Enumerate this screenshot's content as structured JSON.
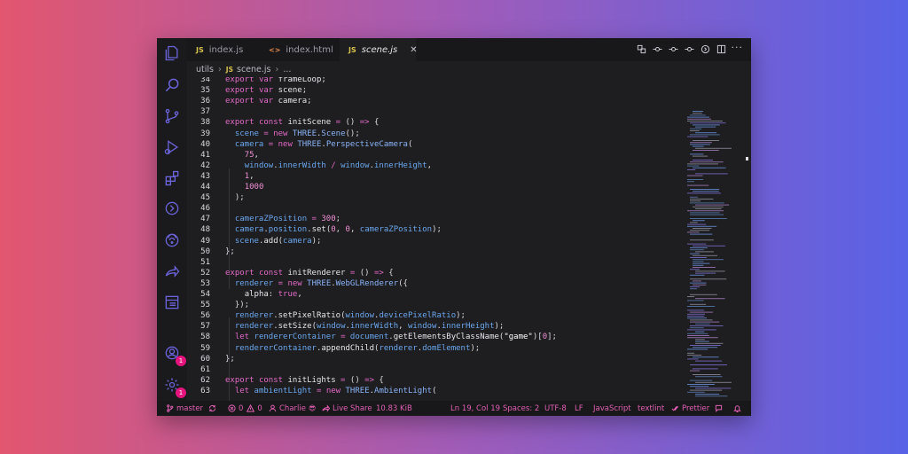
{
  "tabs": [
    {
      "label": "index.js",
      "type": "JS",
      "active": false
    },
    {
      "label": "index.html",
      "type": "<>",
      "active": false
    },
    {
      "label": "scene.js",
      "type": "JS",
      "active": true,
      "close": "✕"
    }
  ],
  "breadcrumb": {
    "folder": "utils",
    "file_type": "JS",
    "file": "scene.js",
    "more": "..."
  },
  "toolbar": {
    "more": "···"
  },
  "code_lines": [
    {
      "n": "34",
      "t": [
        [
          "kw",
          "export "
        ],
        [
          "kw",
          "var "
        ],
        [
          "fn",
          "frameLoop"
        ],
        [
          "p",
          ";"
        ]
      ]
    },
    {
      "n": "35",
      "t": [
        [
          "kw",
          "export "
        ],
        [
          "kw",
          "var "
        ],
        [
          "fn",
          "scene"
        ],
        [
          "p",
          ";"
        ]
      ]
    },
    {
      "n": "36",
      "t": [
        [
          "kw",
          "export "
        ],
        [
          "kw",
          "var "
        ],
        [
          "fn",
          "camera"
        ],
        [
          "p",
          ";"
        ]
      ]
    },
    {
      "n": "37",
      "t": []
    },
    {
      "n": "38",
      "t": [
        [
          "kw",
          "export "
        ],
        [
          "kw",
          "const "
        ],
        [
          "fn",
          "initScene"
        ],
        [
          "op",
          " = "
        ],
        [
          "p",
          "() "
        ],
        [
          "op",
          "=>"
        ],
        [
          "p",
          " {"
        ]
      ]
    },
    {
      "n": "39",
      "t": [
        [
          "p",
          "  "
        ],
        [
          "prop",
          "scene"
        ],
        [
          "op",
          " = "
        ],
        [
          "kw",
          "new "
        ],
        [
          "cls",
          "THREE"
        ],
        [
          "p",
          "."
        ],
        [
          "cls",
          "Scene"
        ],
        [
          "p",
          "();"
        ]
      ]
    },
    {
      "n": "40",
      "t": [
        [
          "p",
          "  "
        ],
        [
          "prop",
          "camera"
        ],
        [
          "op",
          " = "
        ],
        [
          "kw",
          "new "
        ],
        [
          "cls",
          "THREE"
        ],
        [
          "p",
          "."
        ],
        [
          "cls",
          "PerspectiveCamera"
        ],
        [
          "p",
          "("
        ]
      ]
    },
    {
      "n": "41",
      "t": [
        [
          "p",
          "    "
        ],
        [
          "num",
          "75"
        ],
        [
          "p",
          ","
        ]
      ]
    },
    {
      "n": "42",
      "t": [
        [
          "p",
          "    "
        ],
        [
          "prop",
          "window"
        ],
        [
          "p",
          "."
        ],
        [
          "prop",
          "innerWidth"
        ],
        [
          "op",
          " / "
        ],
        [
          "prop",
          "window"
        ],
        [
          "p",
          "."
        ],
        [
          "prop",
          "innerHeight"
        ],
        [
          "p",
          ","
        ]
      ]
    },
    {
      "n": "43",
      "t": [
        [
          "p",
          "    "
        ],
        [
          "num",
          "1"
        ],
        [
          "p",
          ","
        ]
      ]
    },
    {
      "n": "44",
      "t": [
        [
          "p",
          "    "
        ],
        [
          "num",
          "1000"
        ]
      ]
    },
    {
      "n": "45",
      "t": [
        [
          "p",
          "  );"
        ]
      ]
    },
    {
      "n": "46",
      "t": []
    },
    {
      "n": "47",
      "t": [
        [
          "p",
          "  "
        ],
        [
          "prop",
          "cameraZPosition"
        ],
        [
          "op",
          " = "
        ],
        [
          "num",
          "300"
        ],
        [
          "p",
          ";"
        ]
      ]
    },
    {
      "n": "48",
      "t": [
        [
          "p",
          "  "
        ],
        [
          "prop",
          "camera"
        ],
        [
          "p",
          "."
        ],
        [
          "prop",
          "position"
        ],
        [
          "p",
          "."
        ],
        [
          "fn",
          "set"
        ],
        [
          "p",
          "("
        ],
        [
          "num",
          "0"
        ],
        [
          "p",
          ", "
        ],
        [
          "num",
          "0"
        ],
        [
          "p",
          ", "
        ],
        [
          "prop",
          "cameraZPosition"
        ],
        [
          "p",
          ");"
        ]
      ]
    },
    {
      "n": "49",
      "t": [
        [
          "p",
          "  "
        ],
        [
          "prop",
          "scene"
        ],
        [
          "p",
          "."
        ],
        [
          "fn",
          "add"
        ],
        [
          "p",
          "("
        ],
        [
          "prop",
          "camera"
        ],
        [
          "p",
          ");"
        ]
      ]
    },
    {
      "n": "50",
      "t": [
        [
          "p",
          "};"
        ]
      ]
    },
    {
      "n": "51",
      "t": []
    },
    {
      "n": "52",
      "t": [
        [
          "kw",
          "export "
        ],
        [
          "kw",
          "const "
        ],
        [
          "fn",
          "initRenderer"
        ],
        [
          "op",
          " = "
        ],
        [
          "p",
          "() "
        ],
        [
          "op",
          "=>"
        ],
        [
          "p",
          " {"
        ]
      ]
    },
    {
      "n": "53",
      "t": [
        [
          "p",
          "  "
        ],
        [
          "prop",
          "renderer"
        ],
        [
          "op",
          " = "
        ],
        [
          "kw",
          "new "
        ],
        [
          "cls",
          "THREE"
        ],
        [
          "p",
          "."
        ],
        [
          "cls",
          "WebGLRenderer"
        ],
        [
          "p",
          "({"
        ]
      ]
    },
    {
      "n": "54",
      "t": [
        [
          "p",
          "    "
        ],
        [
          "fn",
          "alpha"
        ],
        [
          "p",
          ": "
        ],
        [
          "kw",
          "true"
        ],
        [
          "p",
          ","
        ]
      ]
    },
    {
      "n": "55",
      "t": [
        [
          "p",
          "  });"
        ]
      ]
    },
    {
      "n": "56",
      "t": [
        [
          "p",
          "  "
        ],
        [
          "prop",
          "renderer"
        ],
        [
          "p",
          "."
        ],
        [
          "fn",
          "setPixelRatio"
        ],
        [
          "p",
          "("
        ],
        [
          "prop",
          "window"
        ],
        [
          "p",
          "."
        ],
        [
          "prop",
          "devicePixelRatio"
        ],
        [
          "p",
          ");"
        ]
      ]
    },
    {
      "n": "57",
      "t": [
        [
          "p",
          "  "
        ],
        [
          "prop",
          "renderer"
        ],
        [
          "p",
          "."
        ],
        [
          "fn",
          "setSize"
        ],
        [
          "p",
          "("
        ],
        [
          "prop",
          "window"
        ],
        [
          "p",
          "."
        ],
        [
          "prop",
          "innerWidth"
        ],
        [
          "p",
          ", "
        ],
        [
          "prop",
          "window"
        ],
        [
          "p",
          "."
        ],
        [
          "prop",
          "innerHeight"
        ],
        [
          "p",
          ");"
        ]
      ]
    },
    {
      "n": "58",
      "t": [
        [
          "p",
          "  "
        ],
        [
          "kw",
          "let "
        ],
        [
          "prop",
          "rendererContainer"
        ],
        [
          "op",
          " = "
        ],
        [
          "prop",
          "document"
        ],
        [
          "p",
          "."
        ],
        [
          "fn",
          "getElementsByClassName"
        ],
        [
          "p",
          "("
        ],
        [
          "str",
          "\"game\""
        ],
        [
          "p",
          ")["
        ],
        [
          "num",
          "0"
        ],
        [
          "p",
          "];"
        ]
      ]
    },
    {
      "n": "59",
      "t": [
        [
          "p",
          "  "
        ],
        [
          "prop",
          "rendererContainer"
        ],
        [
          "p",
          "."
        ],
        [
          "fn",
          "appendChild"
        ],
        [
          "p",
          "("
        ],
        [
          "prop",
          "renderer"
        ],
        [
          "p",
          "."
        ],
        [
          "prop",
          "domElement"
        ],
        [
          "p",
          ");"
        ]
      ]
    },
    {
      "n": "60",
      "t": [
        [
          "p",
          "};"
        ]
      ]
    },
    {
      "n": "61",
      "t": []
    },
    {
      "n": "62",
      "t": [
        [
          "kw",
          "export "
        ],
        [
          "kw",
          "const "
        ],
        [
          "fn",
          "initLights"
        ],
        [
          "op",
          " = "
        ],
        [
          "p",
          "() "
        ],
        [
          "op",
          "=>"
        ],
        [
          "p",
          " {"
        ]
      ]
    },
    {
      "n": "63",
      "t": [
        [
          "p",
          "  "
        ],
        [
          "kw",
          "let "
        ],
        [
          "prop",
          "ambientLight"
        ],
        [
          "op",
          " = "
        ],
        [
          "kw",
          "new "
        ],
        [
          "cls",
          "THREE"
        ],
        [
          "p",
          "."
        ],
        [
          "cls",
          "AmbientLight"
        ],
        [
          "p",
          "("
        ]
      ]
    }
  ],
  "activity_badges": {
    "accounts": "1",
    "settings": "1"
  },
  "status": {
    "branch": "master",
    "errors": "0",
    "warnings": "0",
    "user": "Charlie",
    "user_emoji": "😎",
    "live_share": "Live Share",
    "size": "10.83 KiB",
    "position": "Ln 19, Col 19",
    "spaces": "Spaces: 2",
    "encoding": "UTF-8",
    "eol": "LF",
    "language": "JavaScript",
    "linter": "textlint",
    "formatter": "Prettier"
  },
  "colors": {
    "accent_pink": "#e5147d",
    "status_text": "#e35fb4",
    "keyword": "#e369c7",
    "property": "#6aa7ee"
  }
}
